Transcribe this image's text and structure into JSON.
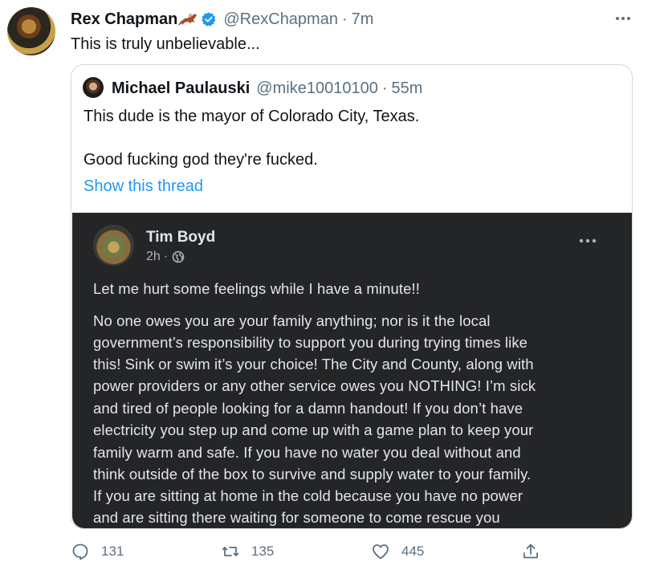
{
  "tweet": {
    "author_name": "Rex Chapman",
    "author_emoji_icon": "horse-racing-emoji",
    "handle": "@RexChapman",
    "separator": "·",
    "time": "7m",
    "text": "This is truly unbelievable..."
  },
  "quote": {
    "author_name": "Michael Paulauski",
    "handle": "@mike10010100",
    "separator": "·",
    "time": "55m",
    "lines": [
      "This dude is the mayor of Colorado City, Texas.",
      "Good fucking god they're fucked."
    ],
    "show_thread": "Show this thread"
  },
  "fb_post": {
    "author": "Tim Boyd",
    "time": "2h",
    "separator": "·",
    "lines": [
      "Let me hurt some feelings while I have a minute!!",
      "No one owes you are your family anything; nor is it the local",
      "government’s responsibility to support you during trying times like",
      "this! Sink or swim it’s your choice!  The City and County, along with",
      "power providers or any other service owes you NOTHING!  I’m sick",
      "and tired of people looking for a damn handout!  If you don’t have",
      "electricity you step up and come up with a game plan to keep your",
      "family warm and safe. If you have no water you deal without and",
      "think outside of the box to survive and supply water to your family.",
      "If you are sitting at home in the cold because you have no power",
      "and are sitting there waiting for someone to come rescue you"
    ]
  },
  "actions": {
    "replies": "131",
    "retweets": "135",
    "likes": "445"
  },
  "colors": {
    "accent": "#1d9bf0",
    "secondary_text": "#5b7083",
    "fb_background": "#242526"
  }
}
